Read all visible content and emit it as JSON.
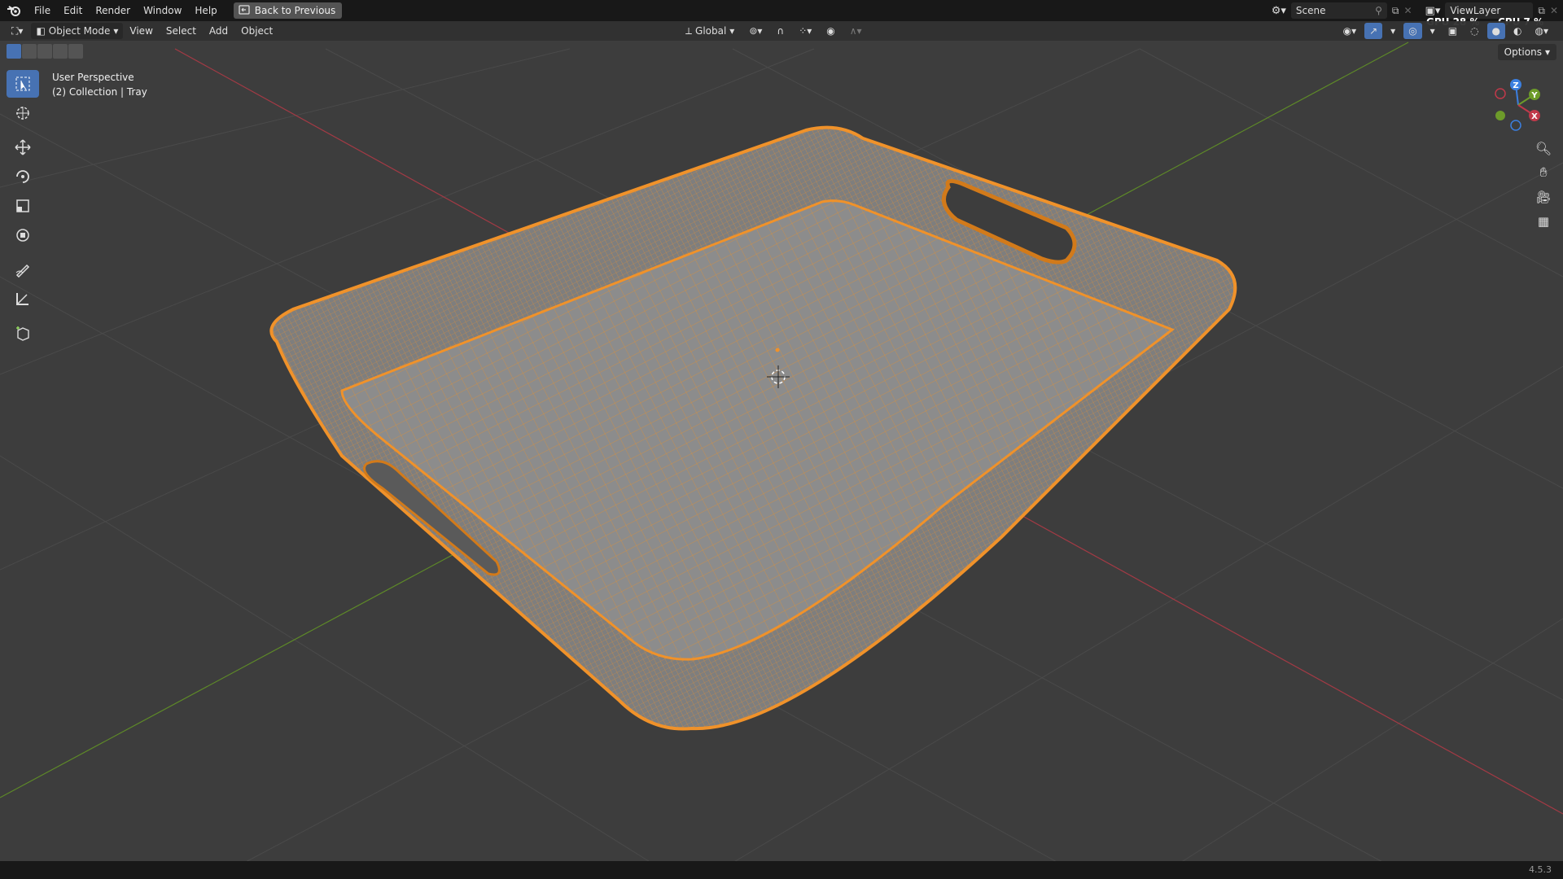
{
  "menubar": {
    "items": [
      "File",
      "Edit",
      "Render",
      "Window",
      "Help"
    ],
    "back_button": "Back to Previous"
  },
  "top_right": {
    "scene": "Scene",
    "view_layer": "ViewLayer"
  },
  "stats": {
    "gpu_label": "GPU",
    "gpu_value": "28 %",
    "cpu_label": "CPU",
    "cpu_value": "7 %"
  },
  "header": {
    "mode": "Object Mode",
    "menus": [
      "View",
      "Select",
      "Add",
      "Object"
    ],
    "transform_orientation": "Global",
    "options": "Options"
  },
  "viewport": {
    "perspective": "User Perspective",
    "collection": "(2) Collection | Tray"
  },
  "gizmo": {
    "z": "Z",
    "y": "Y",
    "x": "X"
  },
  "status": {
    "version": "4.5.3"
  },
  "colors": {
    "accent": "#4772b3",
    "selection": "#f0922a",
    "x_axis": "#c0394a",
    "y_axis": "#6d9b2a",
    "z_axis": "#3b7fe0"
  }
}
